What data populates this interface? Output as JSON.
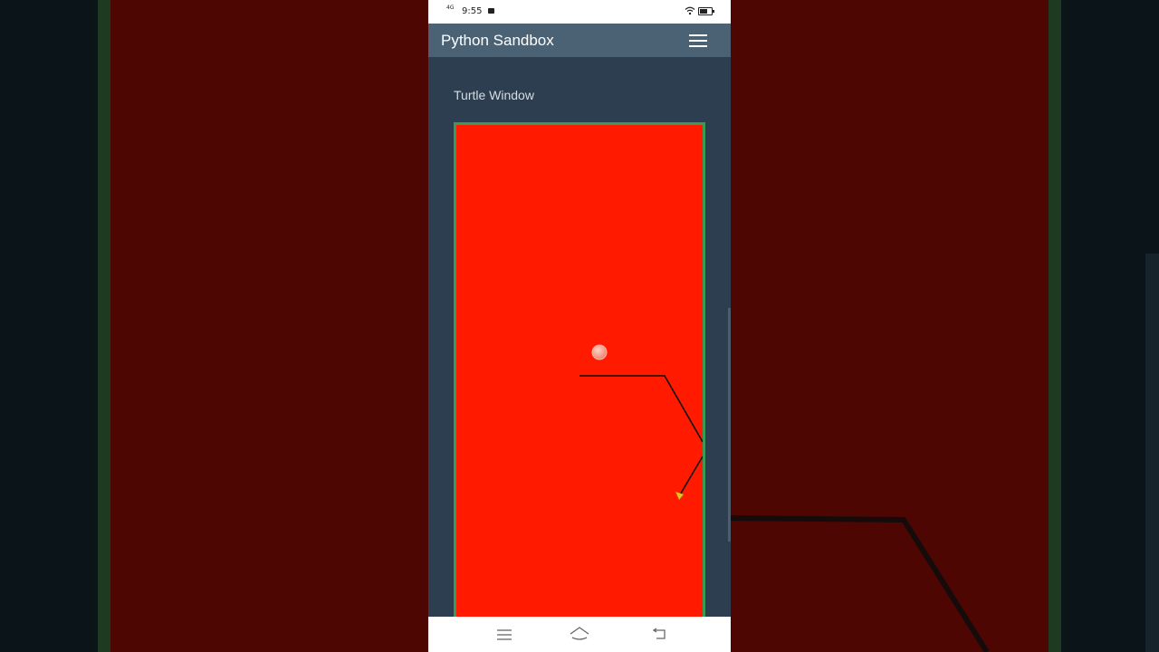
{
  "status_bar": {
    "network": "4G",
    "time": "9:55"
  },
  "app_bar": {
    "title": "Python Sandbox",
    "menu_icon": "hamburger-icon"
  },
  "turtle_section": {
    "title": "Turtle Window",
    "canvas_background": "#ff1a00",
    "canvas_border": "#3c9a57",
    "pen_color": "#111111",
    "dot_color": "#f0a090",
    "turtle_color": "#f0c020"
  },
  "nav_bar": {
    "buttons": [
      "menu-icon",
      "home-icon",
      "back-icon"
    ]
  }
}
